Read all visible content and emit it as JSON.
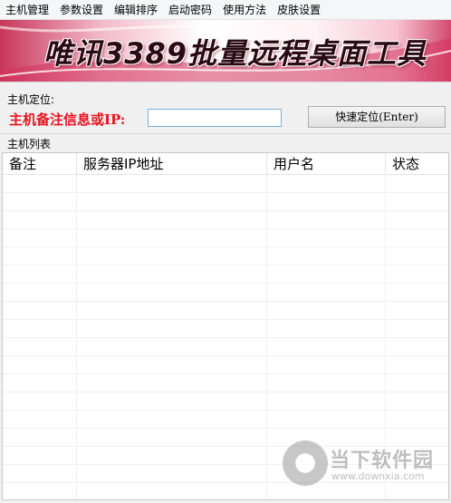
{
  "menu": [
    {
      "label": "主机管理"
    },
    {
      "label": "参数设置"
    },
    {
      "label": "编辑排序"
    },
    {
      "label": "启动密码"
    },
    {
      "label": "使用方法"
    },
    {
      "label": "皮肤设置"
    }
  ],
  "banner": {
    "title": "唯讯3389批量远程桌面工具"
  },
  "locate": {
    "group_label": "主机定位:",
    "field_label": "主机备注信息或IP:",
    "input_value": "",
    "button_label": "快速定位(Enter)"
  },
  "host_list": {
    "group_label": "主机列表",
    "columns": [
      "备注",
      "服务器IP地址",
      "用户名",
      "状态"
    ],
    "rows": []
  },
  "watermark": {
    "name": "当下软件园",
    "url": "www.downxia.com"
  },
  "colors": {
    "accent_red": "#e8141e",
    "banner_pink": "#c8365a"
  }
}
